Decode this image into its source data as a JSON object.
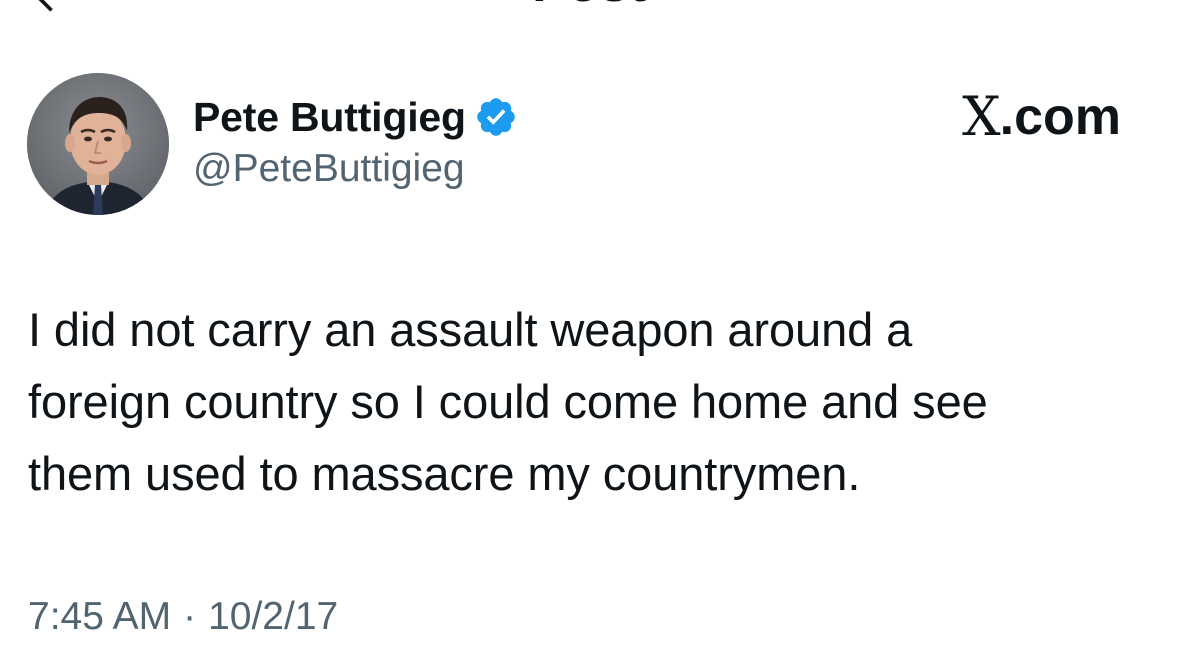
{
  "header": {
    "title": "Post",
    "back_icon": "arrow-left-icon"
  },
  "author": {
    "display_name": "Pete Buttigieg",
    "handle": "@PeteButtigieg",
    "verified": true,
    "verified_icon": "verified-badge-icon",
    "verified_color": "#1d9bf0"
  },
  "site": {
    "logo_glyph": "X",
    "suffix": ".com"
  },
  "tweet": {
    "lines": [
      "I did not carry an assault weapon around a",
      "foreign country so I could come home and see",
      "them used to massacre my countrymen."
    ]
  },
  "meta": {
    "time": "7:45 AM",
    "separator": "·",
    "date": "10/2/17"
  },
  "colors": {
    "text_primary": "#0f1419",
    "text_secondary": "#536471",
    "background": "#ffffff"
  }
}
